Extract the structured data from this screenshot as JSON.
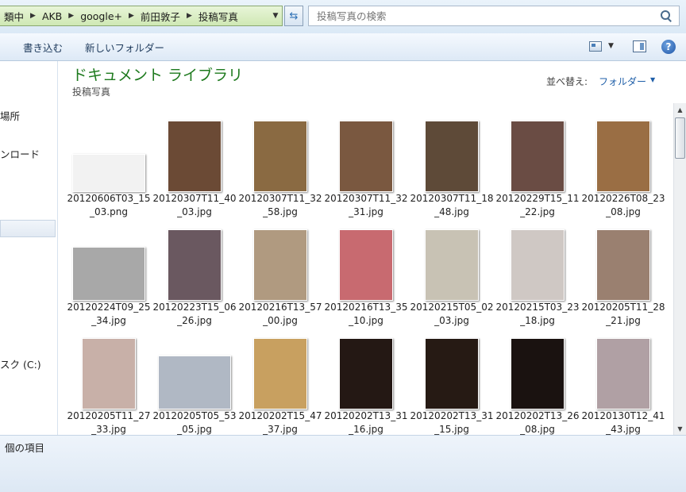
{
  "breadcrumbs": [
    "類中",
    "AKB",
    "google+",
    "前田敦子",
    "投稿写真"
  ],
  "search": {
    "placeholder": "投稿写真の検索"
  },
  "toolbar": {
    "write": "書き込む",
    "new_folder": "新しいフォルダー"
  },
  "nav": {
    "items": [
      {
        "label": "場所"
      },
      {
        "label": "ンロード"
      },
      {
        "label": "スク (C:)"
      }
    ]
  },
  "library": {
    "title": "ドキュメント ライブラリ",
    "subtitle": "投稿写真",
    "sort_label": "並べ替え:",
    "sort_value": "フォルダー"
  },
  "files": [
    {
      "name": "20120606T03_15_03.png",
      "w": 92,
      "h": 48,
      "color": "#f2f2f2"
    },
    {
      "name": "20120307T11_40_03.jpg",
      "w": 68,
      "h": 90,
      "color": "#6b4a35"
    },
    {
      "name": "20120307T11_32_58.jpg",
      "w": 68,
      "h": 90,
      "color": "#8a6a42"
    },
    {
      "name": "20120307T11_32_31.jpg",
      "w": 68,
      "h": 90,
      "color": "#7a5840"
    },
    {
      "name": "20120307T11_18_48.jpg",
      "w": 68,
      "h": 90,
      "color": "#5e4a38"
    },
    {
      "name": "20120229T15_11_22.jpg",
      "w": 68,
      "h": 90,
      "color": "#6a4c44"
    },
    {
      "name": "20120226T08_23_08.jpg",
      "w": 68,
      "h": 90,
      "color": "#9a6e44"
    },
    {
      "name": "20120224T09_25_34.jpg",
      "w": 92,
      "h": 68,
      "color": "#a8a8a8"
    },
    {
      "name": "20120223T15_06_26.jpg",
      "w": 68,
      "h": 90,
      "color": "#6a5860"
    },
    {
      "name": "20120216T13_57_00.jpg",
      "w": 68,
      "h": 90,
      "color": "#b09a80"
    },
    {
      "name": "20120216T13_35_10.jpg",
      "w": 68,
      "h": 90,
      "color": "#c86a70"
    },
    {
      "name": "20120215T05_02_03.jpg",
      "w": 68,
      "h": 90,
      "color": "#c8c2b4"
    },
    {
      "name": "20120215T03_23_18.jpg",
      "w": 68,
      "h": 90,
      "color": "#cfc8c4"
    },
    {
      "name": "20120205T11_28_21.jpg",
      "w": 68,
      "h": 90,
      "color": "#9a8070"
    },
    {
      "name": "20120205T11_27_33.jpg",
      "w": 68,
      "h": 90,
      "color": "#c8b0a8"
    },
    {
      "name": "20120205T05_53_05.jpg",
      "w": 92,
      "h": 68,
      "color": "#b0b8c4"
    },
    {
      "name": "20120202T15_47_37.jpg",
      "w": 68,
      "h": 90,
      "color": "#c8a060"
    },
    {
      "name": "20120202T13_31_16.jpg",
      "w": 68,
      "h": 90,
      "color": "#241814"
    },
    {
      "name": "20120202T13_31_15.jpg",
      "w": 68,
      "h": 90,
      "color": "#261a14"
    },
    {
      "name": "20120202T13_26_08.jpg",
      "w": 68,
      "h": 90,
      "color": "#1a1210"
    },
    {
      "name": "20120130T12_41_43.jpg",
      "w": 68,
      "h": 90,
      "color": "#b0a0a4"
    }
  ],
  "status": {
    "text": "個の項目"
  }
}
